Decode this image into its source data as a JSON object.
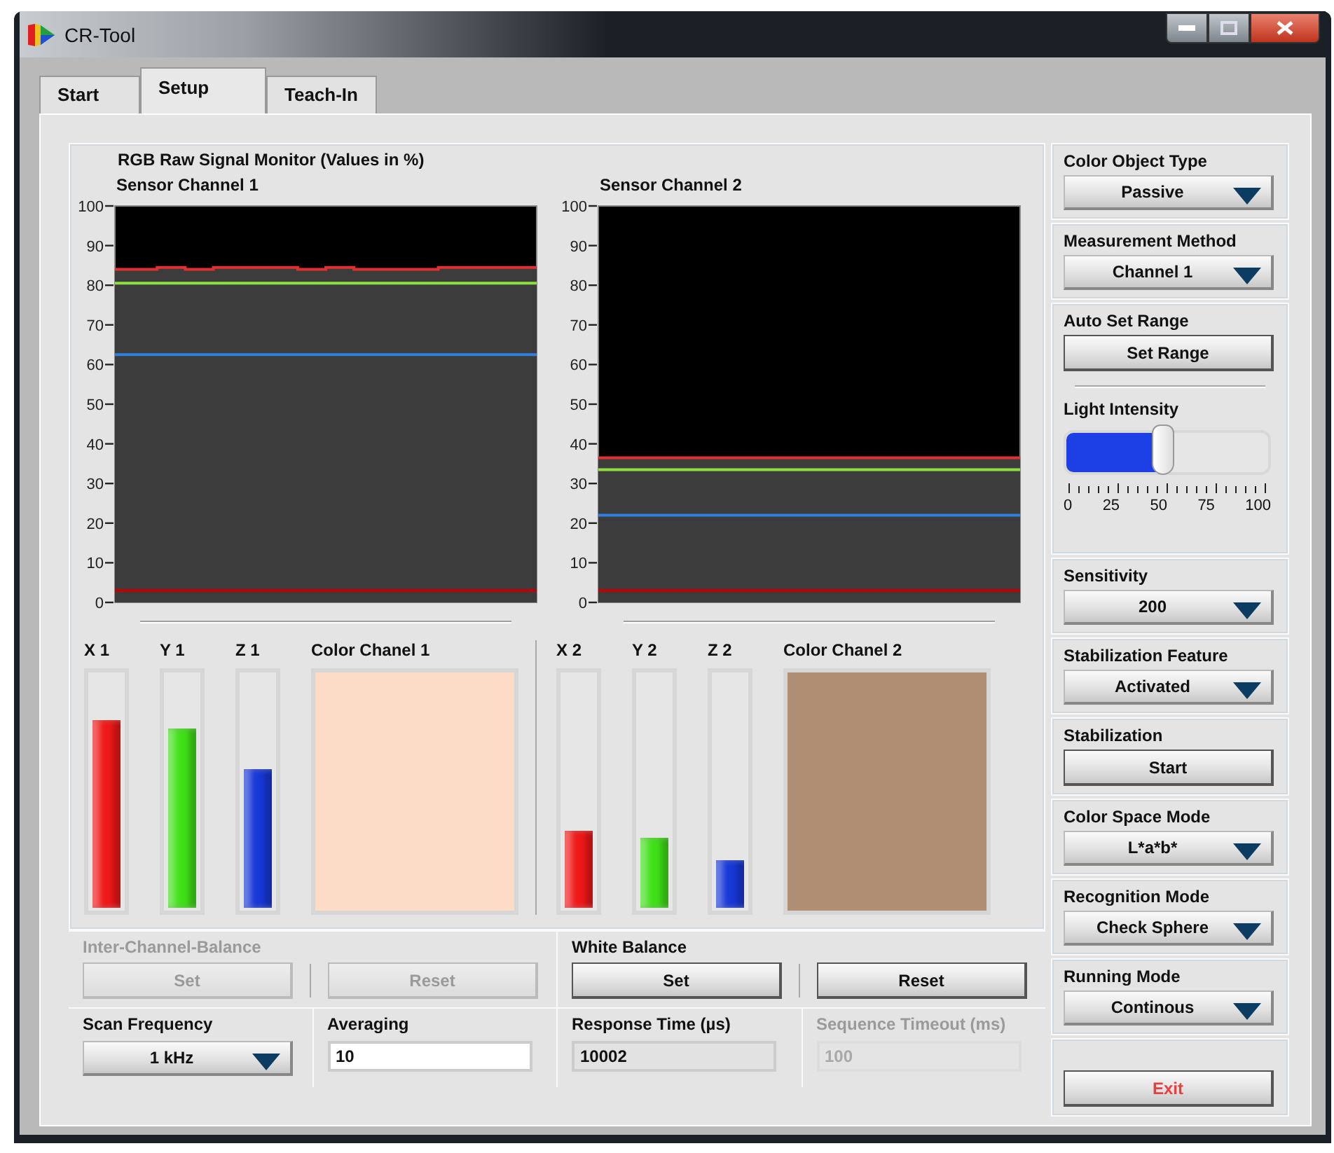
{
  "window": {
    "title": "CR-Tool"
  },
  "tabs": [
    {
      "label": "Start",
      "selected": false
    },
    {
      "label": "Setup",
      "selected": true
    },
    {
      "label": "Teach-In",
      "selected": false
    }
  ],
  "monitor": {
    "title": "RGB Raw Signal Monitor (Values in %)",
    "charts": [
      {
        "chart_data": {
          "type": "line",
          "title": "Sensor Channel 1",
          "ylim": [
            0,
            100
          ],
          "yticks": [
            {
              "value": 0,
              "label": "0"
            },
            {
              "value": 10,
              "label": "10"
            },
            {
              "value": 20,
              "label": "20"
            },
            {
              "value": 30,
              "label": "30"
            },
            {
              "value": 40,
              "label": "40"
            },
            {
              "value": 50,
              "label": "50"
            },
            {
              "value": 60,
              "label": "60"
            },
            {
              "value": 70,
              "label": "70"
            },
            {
              "value": 80,
              "label": "80"
            },
            {
              "value": 90,
              "label": "90"
            },
            {
              "value": 100,
              "label": "100"
            }
          ],
          "series": [
            {
              "color": "#e03030",
              "values": [
                84,
                84,
                84.5,
                84,
                84.5,
                84.5,
                84.5,
                84,
                84.5,
                84,
                84,
                84,
                84.5,
                84.5,
                84.5,
                84.5
              ]
            },
            {
              "color": "#8ee040",
              "values": [
                80.5,
                80.5,
                80.5,
                80.5,
                80.5,
                80.5,
                80.5,
                80.5,
                80.5,
                80.5,
                80.5,
                80.5,
                80.5,
                80.5,
                80.5,
                80.5
              ]
            },
            {
              "color": "#3080e0",
              "values": [
                62.5,
                62.5,
                62.5,
                62.5,
                62.5,
                62.5,
                62.5,
                62.5,
                62.5,
                62.5,
                62.5,
                62.5,
                62.5,
                62.5,
                62.5,
                62.5
              ]
            },
            {
              "color": "#c00000",
              "values": [
                3,
                3,
                3,
                3,
                3,
                3,
                3,
                3,
                3,
                3,
                3,
                3,
                3,
                3,
                3,
                3
              ]
            }
          ]
        }
      },
      {
        "chart_data": {
          "type": "line",
          "title": "Sensor Channel 2",
          "ylim": [
            0,
            100
          ],
          "yticks": [
            {
              "value": 0,
              "label": "0"
            },
            {
              "value": 10,
              "label": "10"
            },
            {
              "value": 20,
              "label": "20"
            },
            {
              "value": 30,
              "label": "30"
            },
            {
              "value": 40,
              "label": "40"
            },
            {
              "value": 50,
              "label": "50"
            },
            {
              "value": 60,
              "label": "60"
            },
            {
              "value": 70,
              "label": "70"
            },
            {
              "value": 80,
              "label": "80"
            },
            {
              "value": 90,
              "label": "90"
            },
            {
              "value": 100,
              "label": "100"
            }
          ],
          "series": [
            {
              "color": "#e03030",
              "values": [
                36.5,
                36.5,
                36.5,
                36.5,
                36.5,
                36.5,
                36.5,
                36.5,
                36.5,
                36.5,
                36.5,
                36.5,
                36.5,
                36.5,
                36.5,
                36.5
              ]
            },
            {
              "color": "#8ee040",
              "values": [
                33.5,
                33.5,
                33.5,
                33.5,
                33.5,
                33.5,
                33.5,
                33.5,
                33.5,
                33.5,
                33.5,
                33.5,
                33.5,
                33.5,
                33.5,
                33.5
              ]
            },
            {
              "color": "#3080e0",
              "values": [
                22,
                22,
                22,
                22,
                22,
                22,
                22,
                22,
                22,
                22,
                22,
                22,
                22,
                22,
                22,
                22
              ]
            },
            {
              "color": "#c00000",
              "values": [
                3,
                3,
                3,
                3,
                3,
                3,
                3,
                3,
                3,
                3,
                3,
                3,
                3,
                3,
                3,
                3
              ]
            }
          ]
        }
      }
    ],
    "channels": [
      {
        "bars": [
          {
            "label": "X 1",
            "level": 0.8,
            "color": "#f01818"
          },
          {
            "label": "Y 1",
            "level": 0.76,
            "color": "#40e018"
          },
          {
            "label": "Z 1",
            "level": 0.59,
            "color": "#1838d8"
          }
        ],
        "swatch_label": "Color Chanel 1",
        "color": "#fcdcc6"
      },
      {
        "bars": [
          {
            "label": "X 2",
            "level": 0.33,
            "color": "#f01818"
          },
          {
            "label": "Y 2",
            "level": 0.3,
            "color": "#40e018"
          },
          {
            "label": "Z 2",
            "level": 0.2,
            "color": "#1838d8"
          }
        ],
        "swatch_label": "Color Chanel 2",
        "color": "#b08e74"
      }
    ]
  },
  "balance_groups": [
    {
      "label": "Inter-Channel-Balance",
      "disabled": true,
      "buttons": [
        "Set",
        "Reset"
      ]
    },
    {
      "label": "White Balance",
      "disabled": false,
      "buttons": [
        "Set",
        "Reset"
      ]
    }
  ],
  "fields": [
    {
      "kind": "dropdown",
      "label": "Scan Frequency",
      "value": "1 kHz",
      "disabled": false
    },
    {
      "kind": "input",
      "label": "Averaging",
      "value": "10",
      "disabled": false
    },
    {
      "kind": "readonly",
      "label": "Response Time (µs)",
      "value": "10002",
      "disabled": false
    },
    {
      "kind": "readonly",
      "label": "Sequence Timeout (ms)",
      "value": "100",
      "disabled": true
    }
  ],
  "settings": [
    {
      "kind": "dropdown",
      "label": "Color Object Type",
      "value": "Passive"
    },
    {
      "kind": "dropdown",
      "label": "Measurement Method",
      "value": "Channel 1"
    },
    {
      "kind": "range",
      "label": "Auto Set Range",
      "button": "Set Range",
      "slider": {
        "label": "Light Intensity",
        "level": 0.48,
        "tick_labels": [
          "0",
          "25",
          "50",
          "75",
          "100"
        ]
      }
    },
    {
      "kind": "dropdown",
      "label": "Sensitivity",
      "value": "200"
    },
    {
      "kind": "dropdown",
      "label": "Stabilization Feature",
      "value": "Activated"
    },
    {
      "kind": "button",
      "label": "Stabilization",
      "button": "Start"
    },
    {
      "kind": "dropdown",
      "label": "Color Space Mode",
      "value": "L*a*b*"
    },
    {
      "kind": "dropdown",
      "label": "Recognition Mode",
      "value": "Check Sphere"
    },
    {
      "kind": "dropdown",
      "label": "Running Mode",
      "value": "Continous"
    },
    {
      "kind": "exit",
      "button": "Exit"
    }
  ]
}
